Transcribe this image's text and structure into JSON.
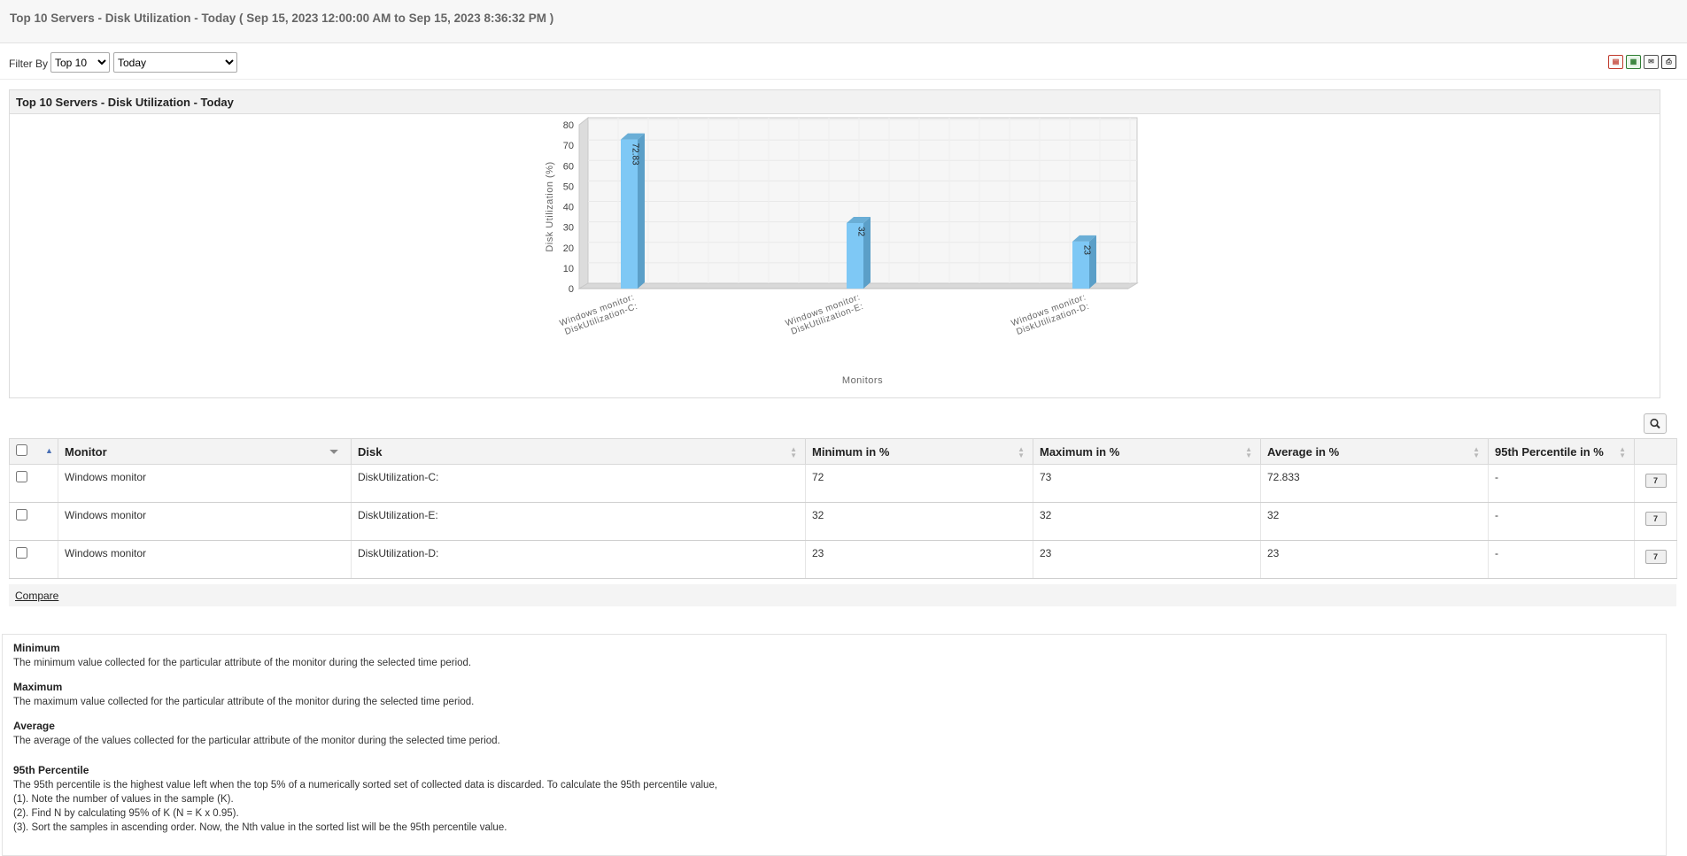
{
  "title": "Top 10 Servers - Disk Utilization - Today ( Sep 15, 2023 12:00:00 AM to Sep 15, 2023 8:36:32 PM )",
  "filter": {
    "label": "Filter By",
    "top_selected": "Top 10",
    "period_selected": "Today"
  },
  "export_icons": [
    "pdf-export-icon",
    "excel-export-icon",
    "email-icon",
    "print-icon"
  ],
  "chart_panel": {
    "header": "Top 10 Servers - Disk Utilization - Today"
  },
  "chart_data": {
    "type": "bar",
    "categories": [
      "Windows monitor: DiskUtilization-C:",
      "Windows monitor: DiskUtilization-E:",
      "Windows monitor: DiskUtilization-D:"
    ],
    "values": [
      72.83,
      32,
      23
    ],
    "value_labels": [
      "72.83",
      "32",
      "23"
    ],
    "ylabel": "Disk Utilization (%)",
    "xlabel": "Monitors",
    "yticks": [
      0,
      10,
      20,
      30,
      40,
      50,
      60,
      70,
      80
    ],
    "ylim": [
      0,
      80
    ],
    "grid": true,
    "bar_color": "#7ec8f5",
    "three_d": true
  },
  "table": {
    "headers": [
      "Monitor",
      "Disk",
      "Minimum in %",
      "Maximum in %",
      "Average in %",
      "95th Percentile in %"
    ],
    "rows": [
      {
        "monitor": "Windows monitor",
        "disk": "DiskUtilization-C:",
        "min": "72",
        "max": "73",
        "avg": "72.833",
        "p95": "-",
        "action": "7"
      },
      {
        "monitor": "Windows monitor",
        "disk": "DiskUtilization-E:",
        "min": "32",
        "max": "32",
        "avg": "32",
        "p95": "-",
        "action": "7"
      },
      {
        "monitor": "Windows monitor",
        "disk": "DiskUtilization-D:",
        "min": "23",
        "max": "23",
        "avg": "23",
        "p95": "-",
        "action": "7"
      }
    ]
  },
  "compare_label": "Compare",
  "notes": {
    "minimum_h": "Minimum",
    "minimum_t": "The minimum value collected for the particular attribute of the monitor during the selected time period.",
    "maximum_h": "Maximum",
    "maximum_t": "The maximum value collected for the particular attribute of the monitor during the selected time period.",
    "average_h": "Average",
    "average_t": "The average of the values collected for the particular attribute of the monitor during the selected time period.",
    "p95_h": "95th Percentile",
    "p95_t": "The 95th percentile is the highest value left when the top 5% of a numerically sorted set of collected data is discarded. To calculate the 95th percentile value,",
    "p95_s1": "(1). Note the number of values in the sample (K).",
    "p95_s2": "(2). Find N by calculating 95% of K (N = K x 0.95).",
    "p95_s3": "(3). Sort the samples in ascending order. Now, the Nth value in the sorted list will be the 95th percentile value."
  }
}
